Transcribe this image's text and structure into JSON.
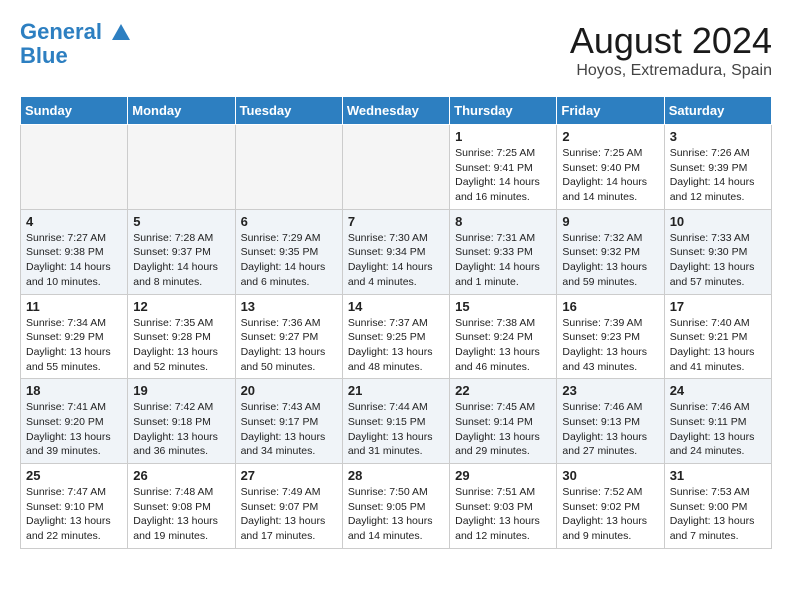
{
  "header": {
    "logo_line1": "General",
    "logo_line2": "Blue",
    "month_year": "August 2024",
    "location": "Hoyos, Extremadura, Spain"
  },
  "weekdays": [
    "Sunday",
    "Monday",
    "Tuesday",
    "Wednesday",
    "Thursday",
    "Friday",
    "Saturday"
  ],
  "weeks": [
    [
      {
        "day": "",
        "info": ""
      },
      {
        "day": "",
        "info": ""
      },
      {
        "day": "",
        "info": ""
      },
      {
        "day": "",
        "info": ""
      },
      {
        "day": "1",
        "info": "Sunrise: 7:25 AM\nSunset: 9:41 PM\nDaylight: 14 hours\nand 16 minutes."
      },
      {
        "day": "2",
        "info": "Sunrise: 7:25 AM\nSunset: 9:40 PM\nDaylight: 14 hours\nand 14 minutes."
      },
      {
        "day": "3",
        "info": "Sunrise: 7:26 AM\nSunset: 9:39 PM\nDaylight: 14 hours\nand 12 minutes."
      }
    ],
    [
      {
        "day": "4",
        "info": "Sunrise: 7:27 AM\nSunset: 9:38 PM\nDaylight: 14 hours\nand 10 minutes."
      },
      {
        "day": "5",
        "info": "Sunrise: 7:28 AM\nSunset: 9:37 PM\nDaylight: 14 hours\nand 8 minutes."
      },
      {
        "day": "6",
        "info": "Sunrise: 7:29 AM\nSunset: 9:35 PM\nDaylight: 14 hours\nand 6 minutes."
      },
      {
        "day": "7",
        "info": "Sunrise: 7:30 AM\nSunset: 9:34 PM\nDaylight: 14 hours\nand 4 minutes."
      },
      {
        "day": "8",
        "info": "Sunrise: 7:31 AM\nSunset: 9:33 PM\nDaylight: 14 hours\nand 1 minute."
      },
      {
        "day": "9",
        "info": "Sunrise: 7:32 AM\nSunset: 9:32 PM\nDaylight: 13 hours\nand 59 minutes."
      },
      {
        "day": "10",
        "info": "Sunrise: 7:33 AM\nSunset: 9:30 PM\nDaylight: 13 hours\nand 57 minutes."
      }
    ],
    [
      {
        "day": "11",
        "info": "Sunrise: 7:34 AM\nSunset: 9:29 PM\nDaylight: 13 hours\nand 55 minutes."
      },
      {
        "day": "12",
        "info": "Sunrise: 7:35 AM\nSunset: 9:28 PM\nDaylight: 13 hours\nand 52 minutes."
      },
      {
        "day": "13",
        "info": "Sunrise: 7:36 AM\nSunset: 9:27 PM\nDaylight: 13 hours\nand 50 minutes."
      },
      {
        "day": "14",
        "info": "Sunrise: 7:37 AM\nSunset: 9:25 PM\nDaylight: 13 hours\nand 48 minutes."
      },
      {
        "day": "15",
        "info": "Sunrise: 7:38 AM\nSunset: 9:24 PM\nDaylight: 13 hours\nand 46 minutes."
      },
      {
        "day": "16",
        "info": "Sunrise: 7:39 AM\nSunset: 9:23 PM\nDaylight: 13 hours\nand 43 minutes."
      },
      {
        "day": "17",
        "info": "Sunrise: 7:40 AM\nSunset: 9:21 PM\nDaylight: 13 hours\nand 41 minutes."
      }
    ],
    [
      {
        "day": "18",
        "info": "Sunrise: 7:41 AM\nSunset: 9:20 PM\nDaylight: 13 hours\nand 39 minutes."
      },
      {
        "day": "19",
        "info": "Sunrise: 7:42 AM\nSunset: 9:18 PM\nDaylight: 13 hours\nand 36 minutes."
      },
      {
        "day": "20",
        "info": "Sunrise: 7:43 AM\nSunset: 9:17 PM\nDaylight: 13 hours\nand 34 minutes."
      },
      {
        "day": "21",
        "info": "Sunrise: 7:44 AM\nSunset: 9:15 PM\nDaylight: 13 hours\nand 31 minutes."
      },
      {
        "day": "22",
        "info": "Sunrise: 7:45 AM\nSunset: 9:14 PM\nDaylight: 13 hours\nand 29 minutes."
      },
      {
        "day": "23",
        "info": "Sunrise: 7:46 AM\nSunset: 9:13 PM\nDaylight: 13 hours\nand 27 minutes."
      },
      {
        "day": "24",
        "info": "Sunrise: 7:46 AM\nSunset: 9:11 PM\nDaylight: 13 hours\nand 24 minutes."
      }
    ],
    [
      {
        "day": "25",
        "info": "Sunrise: 7:47 AM\nSunset: 9:10 PM\nDaylight: 13 hours\nand 22 minutes."
      },
      {
        "day": "26",
        "info": "Sunrise: 7:48 AM\nSunset: 9:08 PM\nDaylight: 13 hours\nand 19 minutes."
      },
      {
        "day": "27",
        "info": "Sunrise: 7:49 AM\nSunset: 9:07 PM\nDaylight: 13 hours\nand 17 minutes."
      },
      {
        "day": "28",
        "info": "Sunrise: 7:50 AM\nSunset: 9:05 PM\nDaylight: 13 hours\nand 14 minutes."
      },
      {
        "day": "29",
        "info": "Sunrise: 7:51 AM\nSunset: 9:03 PM\nDaylight: 13 hours\nand 12 minutes."
      },
      {
        "day": "30",
        "info": "Sunrise: 7:52 AM\nSunset: 9:02 PM\nDaylight: 13 hours\nand 9 minutes."
      },
      {
        "day": "31",
        "info": "Sunrise: 7:53 AM\nSunset: 9:00 PM\nDaylight: 13 hours\nand 7 minutes."
      }
    ]
  ]
}
